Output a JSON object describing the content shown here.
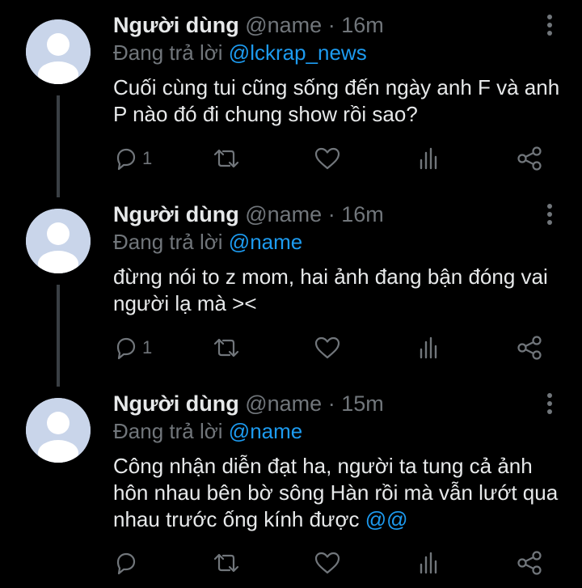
{
  "colors": {
    "background": "#000000",
    "text": "#e7e9ea",
    "muted": "#71767b",
    "accent": "#1d9bf0",
    "avatar_bg": "#c9d5ea",
    "avatar_fg": "#ffffff"
  },
  "tweets": [
    {
      "name": "Người dùng",
      "handle": "@name",
      "separator": "·",
      "time": "16m",
      "replying_prefix": "Đang trả lời",
      "replying_to": "@lckrap_news",
      "text": "Cuối cùng tui cũng sống đến ngày anh F và anh P nào đó đi chung show rồi sao?",
      "mention_suffix": "",
      "reply_count": "1",
      "icons": [
        "reply-icon",
        "retweet-icon",
        "like-icon",
        "views-icon",
        "share-icon",
        "more-icon"
      ]
    },
    {
      "name": "Người dùng",
      "handle": "@name",
      "separator": "·",
      "time": "16m",
      "replying_prefix": "Đang trả lời",
      "replying_to": "@name",
      "text": "đừng nói to z mom, hai ảnh đang bận đóng vai người lạ mà ><",
      "mention_suffix": "",
      "reply_count": "1",
      "icons": [
        "reply-icon",
        "retweet-icon",
        "like-icon",
        "views-icon",
        "share-icon",
        "more-icon"
      ]
    },
    {
      "name": "Người dùng",
      "handle": "@name",
      "separator": "·",
      "time": "15m",
      "replying_prefix": "Đang trả lời",
      "replying_to": "@name",
      "text": "Công nhận diễn đạt ha, người ta tung cả ảnh hôn nhau bên bờ sông Hàn rồi mà vẫn lướt qua nhau trước ống kính được ",
      "mention_suffix": "@@",
      "reply_count": "",
      "icons": [
        "reply-icon",
        "retweet-icon",
        "like-icon",
        "views-icon",
        "share-icon",
        "more-icon"
      ]
    }
  ]
}
